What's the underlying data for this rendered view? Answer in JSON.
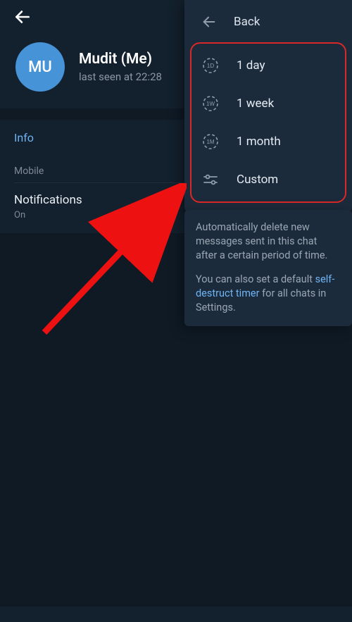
{
  "header": {
    "avatar_initials": "MU",
    "name": "Mudit (Me)",
    "last_seen": "last seen at 22:28"
  },
  "info": {
    "title": "Info",
    "mobile_label": "Mobile",
    "notifications_label": "Notifications",
    "notifications_value": "On"
  },
  "popup": {
    "back_label": "Back",
    "options": {
      "day": {
        "label": "1 day",
        "icon_text": "1D"
      },
      "week": {
        "label": "1 week",
        "icon_text": "1W"
      },
      "month": {
        "label": "1 month",
        "icon_text": "1M"
      },
      "custom": {
        "label": "Custom"
      }
    }
  },
  "description": {
    "p1": "Automatically delete new messages sent in this chat after a certain period of time.",
    "p2a": "You can also set a default ",
    "link": "self-destruct timer",
    "p2b": " for all chats in Settings."
  }
}
